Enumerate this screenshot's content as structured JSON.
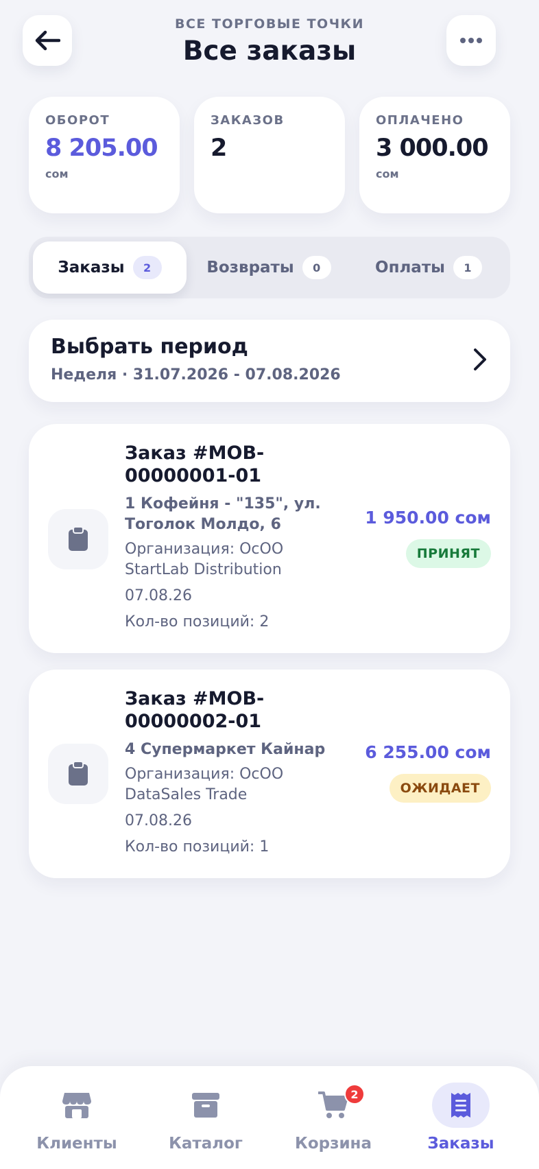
{
  "header": {
    "subtitle": "ВСЕ ТОРГОВЫЕ ТОЧКИ",
    "title": "Все заказы",
    "back_icon": "arrow-left-icon",
    "more_icon": "more-horizontal-icon"
  },
  "stats": [
    {
      "label": "ОБОРОТ",
      "value": "8 205.00",
      "unit": "сом",
      "color": "#5b5bdc"
    },
    {
      "label": "ЗАКАЗОВ",
      "value": "2",
      "unit": ""
    },
    {
      "label": "ОПЛАЧЕНО",
      "value": "3 000.00",
      "unit": "сом"
    }
  ],
  "tabs": [
    {
      "label": "Заказы",
      "count": "2",
      "active": true
    },
    {
      "label": "Возвраты",
      "count": "0",
      "active": false
    },
    {
      "label": "Оплаты",
      "count": "1",
      "active": false
    }
  ],
  "period": {
    "title": "Выбрать период",
    "range": "Неделя · 31.07.2026 - 07.08.2026"
  },
  "orders": [
    {
      "title": "Заказ #MOB-00000001-01",
      "place": "1 Кофейня - \"135\", ул. Тоголок Молдо, 6",
      "org": "Организация: ОсОО StartLab Distribution",
      "date": "07.08.26",
      "count": "Кол-во позиций: 2",
      "amount": "1 950.00 сом",
      "status": "ПРИНЯТ",
      "status_color": "#177a3a",
      "icon": "clipboard-icon"
    },
    {
      "title": "Заказ #MOB-00000002-01",
      "place": "4 Супермаркет Кайнар",
      "org": "Организация: ОсОО DataSales Trade",
      "date": "07.08.26",
      "count": "Кол-во позиций: 1",
      "amount": "6 255.00 сом",
      "status": "ОЖИДАЕТ",
      "status_color": "#8a4a0f",
      "icon": "clipboard-icon"
    }
  ],
  "bottom_nav": [
    {
      "label": "Клиенты",
      "icon": "store-icon",
      "active": false
    },
    {
      "label": "Каталог",
      "icon": "archive-box-icon",
      "active": false
    },
    {
      "label": "Корзина",
      "icon": "cart-icon",
      "badge": "2",
      "active": false
    },
    {
      "label": "Заказы",
      "icon": "receipt-icon",
      "active": true
    }
  ],
  "colors": {
    "accent": "#5b5bdc",
    "background": "#f3f4f9",
    "text_primary": "#161a2e",
    "text_secondary": "#5e6480",
    "badge_red": "#ef3b3b"
  }
}
